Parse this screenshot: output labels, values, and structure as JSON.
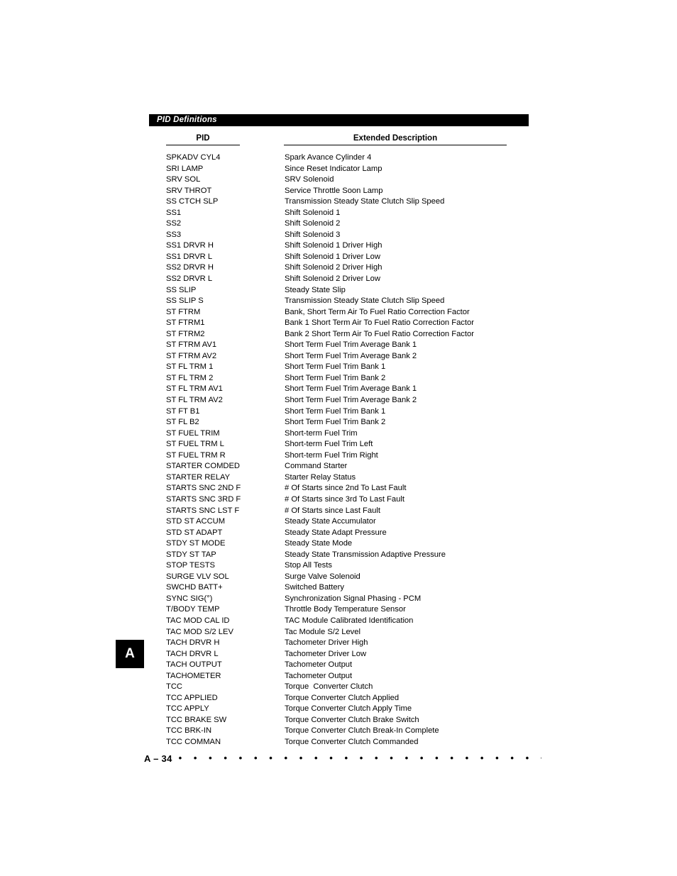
{
  "section": {
    "title": "PID Definitions"
  },
  "table": {
    "headers": {
      "pid": "PID",
      "description": "Extended Description"
    },
    "rows": [
      {
        "pid": "SPKADV CYL4",
        "desc": "Spark Avance Cylinder 4"
      },
      {
        "pid": "SRI LAMP",
        "desc": "Since Reset Indicator Lamp"
      },
      {
        "pid": "SRV SOL",
        "desc": "SRV Solenoid"
      },
      {
        "pid": "SRV THROT",
        "desc": "Service Throttle Soon Lamp"
      },
      {
        "pid": "SS CTCH SLP",
        "desc": "Transmission Steady State Clutch Slip Speed"
      },
      {
        "pid": "SS1",
        "desc": "Shift Solenoid 1"
      },
      {
        "pid": "SS2",
        "desc": "Shift Solenoid 2"
      },
      {
        "pid": "SS3",
        "desc": "Shift Solenoid 3"
      },
      {
        "pid": "SS1 DRVR H",
        "desc": "Shift Solenoid 1 Driver High"
      },
      {
        "pid": "SS1 DRVR L",
        "desc": "Shift Solenoid 1 Driver Low"
      },
      {
        "pid": "SS2 DRVR H",
        "desc": "Shift Solenoid 2 Driver High"
      },
      {
        "pid": "SS2 DRVR L",
        "desc": "Shift Solenoid 2 Driver Low"
      },
      {
        "pid": "SS SLIP",
        "desc": "Steady State Slip"
      },
      {
        "pid": "SS SLIP S",
        "desc": "Transmission Steady State Clutch Slip Speed"
      },
      {
        "pid": "ST FTRM",
        "desc": "Bank, Short Term Air To Fuel Ratio Correction Factor"
      },
      {
        "pid": "ST FTRM1",
        "desc": "Bank 1 Short Term Air To Fuel Ratio Correction Factor"
      },
      {
        "pid": "ST FTRM2",
        "desc": "Bank 2 Short Term Air To Fuel Ratio Correction Factor"
      },
      {
        "pid": "ST FTRM AV1",
        "desc": "Short Term Fuel Trim Average Bank 1"
      },
      {
        "pid": "ST FTRM AV2",
        "desc": "Short Term Fuel Trim Average Bank 2"
      },
      {
        "pid": "ST FL TRM 1",
        "desc": "Short Term Fuel Trim Bank 1"
      },
      {
        "pid": "ST FL TRM 2",
        "desc": "Short Term Fuel Trim Bank 2"
      },
      {
        "pid": "ST FL TRM AV1",
        "desc": "Short Term Fuel Trim Average Bank 1"
      },
      {
        "pid": "ST FL TRM AV2",
        "desc": "Short Term Fuel Trim Average Bank 2"
      },
      {
        "pid": "ST FT B1",
        "desc": "Short Term Fuel Trim Bank 1"
      },
      {
        "pid": "ST FL B2",
        "desc": "Short Term Fuel Trim Bank 2"
      },
      {
        "pid": "ST FUEL TRIM",
        "desc": "Short-term Fuel Trim"
      },
      {
        "pid": "ST FUEL TRM L",
        "desc": "Short-term Fuel Trim Left"
      },
      {
        "pid": "ST FUEL TRM R",
        "desc": "Short-term Fuel Trim Right"
      },
      {
        "pid": "STARTER COMDED",
        "desc": "Command Starter"
      },
      {
        "pid": "STARTER RELAY",
        "desc": "Starter Relay Status"
      },
      {
        "pid": "STARTS SNC 2ND F",
        "desc": "# Of Starts since 2nd To Last Fault"
      },
      {
        "pid": "STARTS SNC 3RD F",
        "desc": "# Of Starts since 3rd To Last Fault"
      },
      {
        "pid": "STARTS SNC LST F",
        "desc": "# Of Starts since Last Fault"
      },
      {
        "pid": "STD ST ACCUM",
        "desc": "Steady State Accumulator"
      },
      {
        "pid": "STD ST ADAPT",
        "desc": "Steady State Adapt Pressure"
      },
      {
        "pid": "STDY ST MODE",
        "desc": "Steady State Mode"
      },
      {
        "pid": "STDY ST TAP",
        "desc": "Steady State Transmission Adaptive Pressure"
      },
      {
        "pid": "STOP TESTS",
        "desc": "Stop All Tests"
      },
      {
        "pid": "SURGE VLV SOL",
        "desc": "Surge Valve Solenoid"
      },
      {
        "pid": "SWCHD BATT+",
        "desc": "Switched Battery"
      },
      {
        "pid": "SYNC SIG(°)",
        "desc": "Synchronization Signal Phasing - PCM"
      },
      {
        "pid": "T/BODY TEMP",
        "desc": "Throttle Body Temperature Sensor"
      },
      {
        "pid": "TAC MOD CAL ID",
        "desc": "TAC Module Calibrated Identification"
      },
      {
        "pid": "TAC MOD S/2 LEV",
        "desc": "Tac Module S/2 Level"
      },
      {
        "pid": "TACH DRVR H",
        "desc": "Tachometer Driver High"
      },
      {
        "pid": "TACH DRVR L",
        "desc": "Tachometer Driver Low"
      },
      {
        "pid": "TACH OUTPUT",
        "desc": "Tachometer Output"
      },
      {
        "pid": "TACHOMETER",
        "desc": "Tachometer Output"
      },
      {
        "pid": "TCC",
        "desc": "Torque  Converter Clutch"
      },
      {
        "pid": "TCC APPLIED",
        "desc": "Torque Converter Clutch Applied"
      },
      {
        "pid": "TCC APPLY",
        "desc": "Torque Converter Clutch Apply Time"
      },
      {
        "pid": "TCC BRAKE SW",
        "desc": "Torque Converter Clutch Brake Switch"
      },
      {
        "pid": "TCC BRK-IN",
        "desc": "Torque Converter Clutch Break-In Complete"
      },
      {
        "pid": "TCC COMMAN",
        "desc": "Torque Converter Clutch Commanded"
      }
    ]
  },
  "thumb_tab": {
    "letter": "A"
  },
  "footer": {
    "page_number": "A – 34",
    "dot_leader": "• • • • • • • • • • • • • • • • • • • • • • • • • • • • • • • • • • • • • • • • • • • • • • •"
  },
  "colors": {
    "bar_background": "#000000",
    "bar_text": "#ffffff",
    "body_text": "#000000",
    "page_background": "#ffffff"
  }
}
